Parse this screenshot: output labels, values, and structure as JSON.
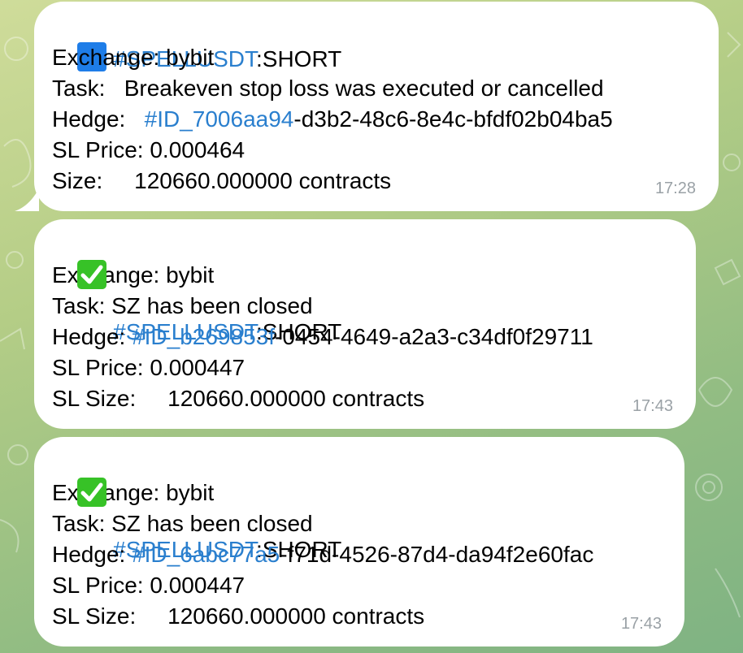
{
  "messages": [
    {
      "icon": "blue-square-icon",
      "symbol_tag": "#SPELLUSDT",
      "side": ":SHORT",
      "exchange_line": "Exchange: bybit",
      "task_line": "Task:   Breakeven stop loss was executed or cancelled",
      "hedge_label": "Hedge:   ",
      "hedge_tag": "#ID_7006aa94",
      "hedge_rest": "-d3b2-48c6-8e4c-bfdf02b04ba5",
      "price_line": "SL Price: 0.000464",
      "size_line": "Size:     120660.000000 contracts",
      "time": "17:28"
    },
    {
      "icon": "check-mark-icon",
      "symbol_tag": "#SPELLUSDT",
      "side": ":SHORT",
      "exchange_line": "Exchange: bybit",
      "task_line": "Task: SZ has been closed",
      "hedge_label": "Hedge: ",
      "hedge_tag": "#ID_b269853f",
      "hedge_rest": "-0454-4649-a2a3-c34df0f29711",
      "price_line": "SL Price: 0.000447",
      "size_line": "SL Size:     120660.000000 contracts",
      "time": "17:43"
    },
    {
      "icon": "check-mark-icon",
      "symbol_tag": "#SPELLUSDT",
      "side": ":SHORT",
      "exchange_line": "Exchange: bybit",
      "task_line": "Task: SZ has been closed",
      "hedge_label": "Hedge: ",
      "hedge_tag": "#ID_6abc77a5",
      "hedge_rest": "-f71d-4526-87d4-da94f2e60fac",
      "price_line": "SL Price: 0.000447",
      "size_line": "SL Size:     120660.000000 contracts",
      "time": "17:43"
    }
  ],
  "colors": {
    "link": "#2a7fce",
    "bubble": "#ffffff",
    "timestamp": "#9aa1a6",
    "check_green": "#37c227",
    "square_blue": "#1e7de8"
  }
}
